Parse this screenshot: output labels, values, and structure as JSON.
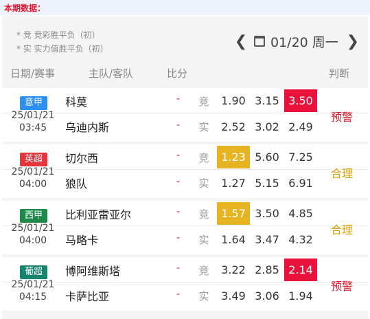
{
  "section_label": "本期数据：",
  "legend": {
    "line1": "* 竞  竞彩胜平负（初）",
    "line2": "* 实  实力值胜平负（初）"
  },
  "date_nav": {
    "prev_icon": "chevron-left-icon",
    "next_icon": "chevron-right-icon",
    "calendar_icon": "calendar-icon",
    "date_text": "01/20 周一"
  },
  "columns": {
    "date_league": "日期/赛事",
    "home_away": "主队/客队",
    "score": "比分",
    "verdict": "判断"
  },
  "colors": {
    "red_highlight": "#e8123c",
    "gold_highlight": "#e6b422",
    "warning_text": "#e0162b",
    "reasonable_text": "#d4a000",
    "league_blue": "#2d8ff0",
    "league_red": "#e8333b",
    "league_green": "#1d8a4a",
    "league_teal": "#16846e"
  },
  "matches": [
    {
      "league": "意甲",
      "league_color": "#2d8ff0",
      "date": "25/01/21",
      "time": "03:45",
      "home": "科莫",
      "away": "乌迪内斯",
      "score_home": "-",
      "score_away": "-",
      "tag1": "竞",
      "tag2": "实",
      "odds1": [
        "1.90",
        "3.15",
        "3.50"
      ],
      "odds2": [
        "2.52",
        "3.02",
        "2.49"
      ],
      "highlight_index": 2,
      "highlight_color": "#e8123c",
      "verdict": "预警",
      "verdict_color": "#e0162b"
    },
    {
      "league": "英超",
      "league_color": "#e8333b",
      "date": "25/01/21",
      "time": "04:00",
      "home": "切尔西",
      "away": "狼队",
      "score_home": "-",
      "score_away": "-",
      "tag1": "竞",
      "tag2": "实",
      "odds1": [
        "1.23",
        "5.60",
        "7.25"
      ],
      "odds2": [
        "1.27",
        "5.15",
        "6.91"
      ],
      "highlight_index": 0,
      "highlight_color": "#e6b422",
      "verdict": "合理",
      "verdict_color": "#d4a000"
    },
    {
      "league": "西甲",
      "league_color": "#1d8a4a",
      "date": "25/01/21",
      "time": "04:00",
      "home": "比利亚雷亚尔",
      "away": "马略卡",
      "score_home": "-",
      "score_away": "-",
      "tag1": "竞",
      "tag2": "实",
      "odds1": [
        "1.57",
        "3.50",
        "4.85"
      ],
      "odds2": [
        "1.64",
        "3.47",
        "4.32"
      ],
      "highlight_index": 0,
      "highlight_color": "#e6b422",
      "verdict": "合理",
      "verdict_color": "#d4a000"
    },
    {
      "league": "葡超",
      "league_color": "#16846e",
      "date": "25/01/21",
      "time": "04:15",
      "home": "博阿维斯塔",
      "away": "卡萨比亚",
      "score_home": "-",
      "score_away": "-",
      "tag1": "竞",
      "tag2": "实",
      "odds1": [
        "3.22",
        "2.85",
        "2.14"
      ],
      "odds2": [
        "3.49",
        "3.06",
        "1.94"
      ],
      "highlight_index": 2,
      "highlight_color": "#e8123c",
      "verdict": "预警",
      "verdict_color": "#e0162b"
    }
  ]
}
